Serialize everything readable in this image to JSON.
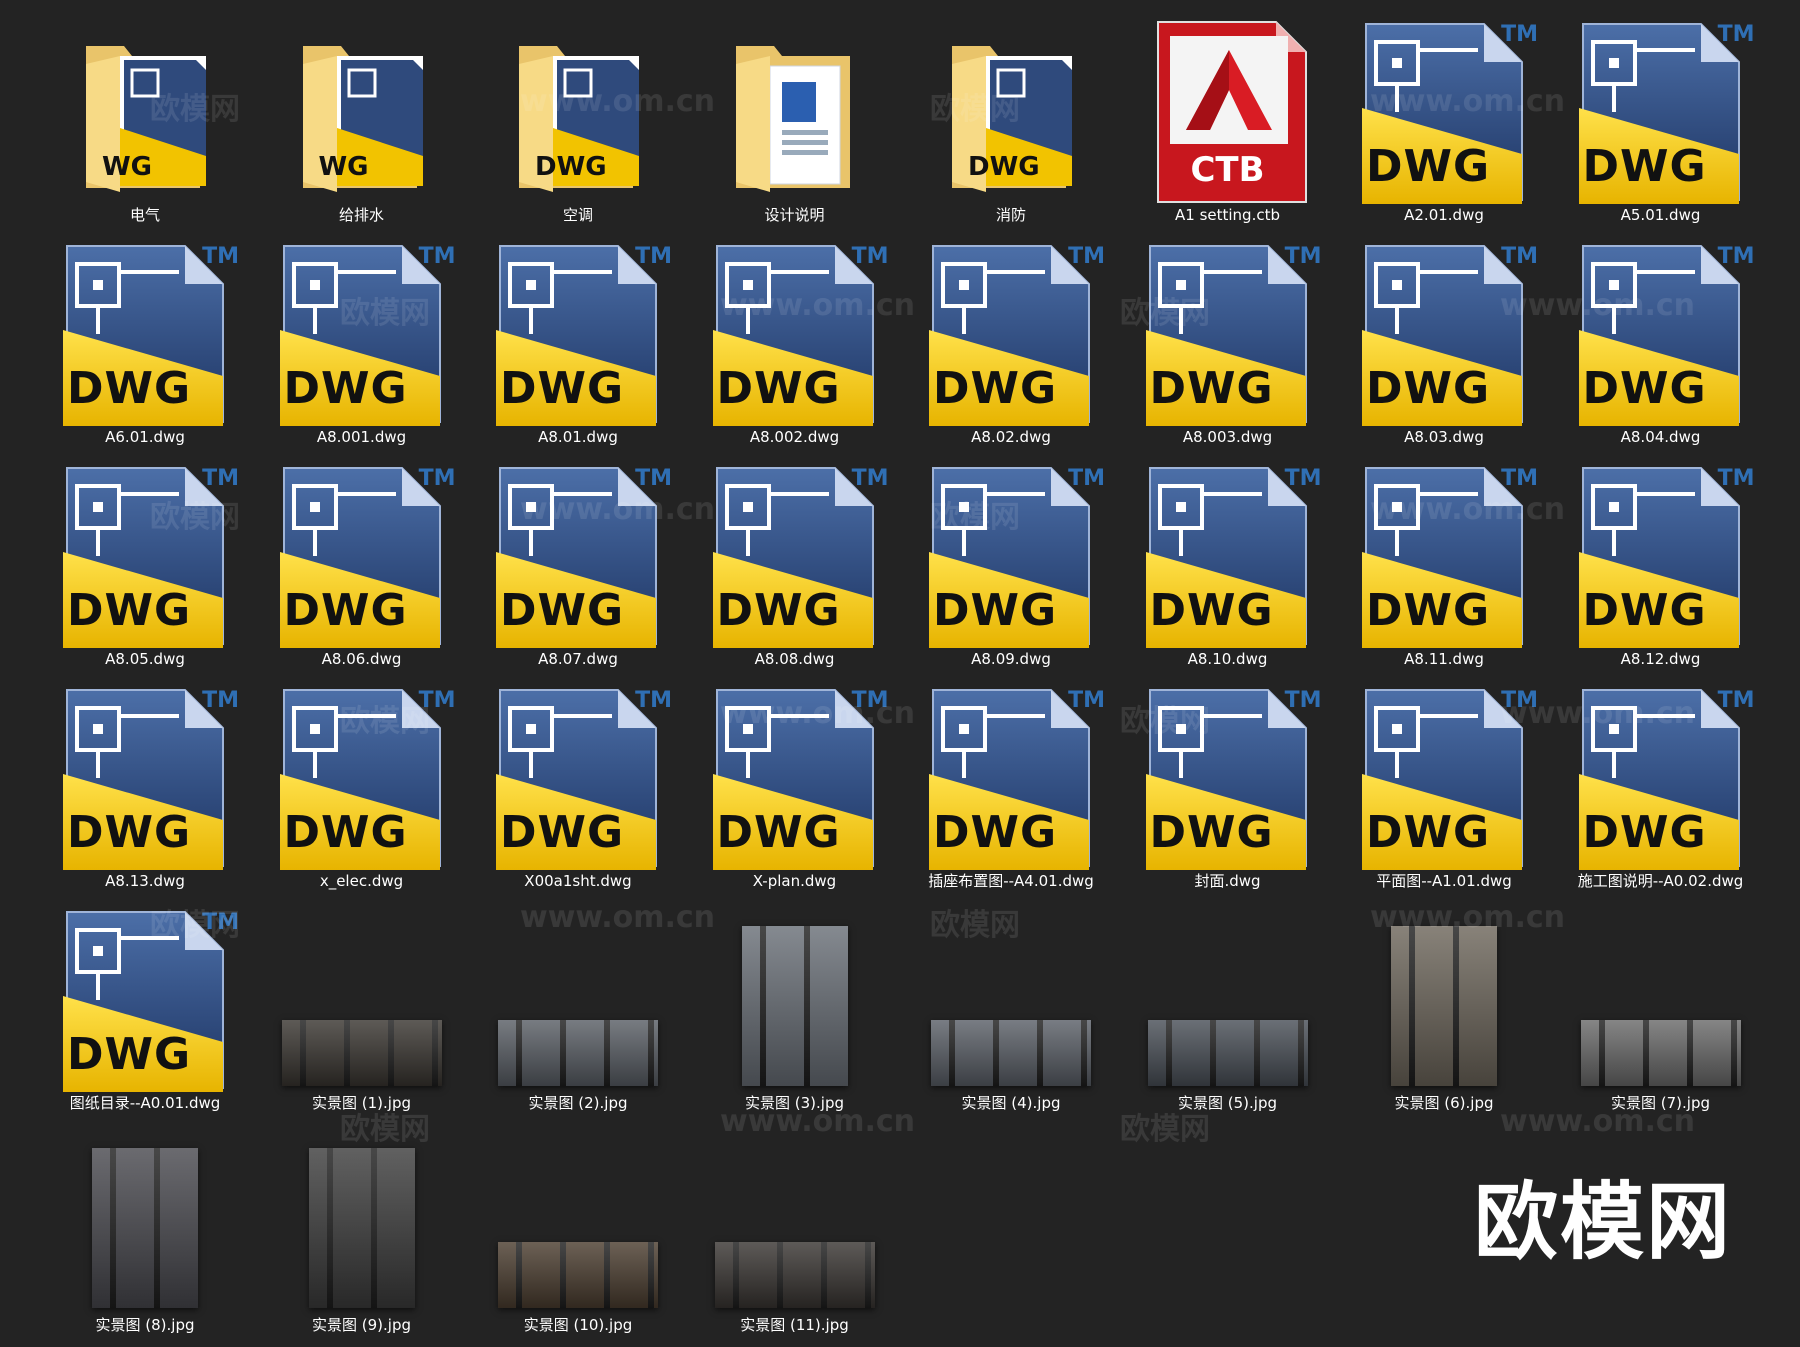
{
  "window": {
    "background": "#232323"
  },
  "items": [
    {
      "type": "folder",
      "label": "电气",
      "badge": "WG"
    },
    {
      "type": "folder",
      "label": "给排水",
      "badge": "WG"
    },
    {
      "type": "folder",
      "label": "空调",
      "badge": "DWG"
    },
    {
      "type": "folder-doc",
      "label": "设计说明"
    },
    {
      "type": "folder",
      "label": "消防",
      "badge": "DWG"
    },
    {
      "type": "ctb",
      "label": "A1  setting.ctb",
      "badge": "CTB"
    },
    {
      "type": "dwg",
      "label": "A2.01.dwg"
    },
    {
      "type": "dwg",
      "label": "A5.01.dwg"
    },
    {
      "type": "dwg",
      "label": "A6.01.dwg"
    },
    {
      "type": "dwg",
      "label": "A8.001.dwg"
    },
    {
      "type": "dwg",
      "label": "A8.01.dwg"
    },
    {
      "type": "dwg",
      "label": "A8.002.dwg"
    },
    {
      "type": "dwg",
      "label": "A8.02.dwg"
    },
    {
      "type": "dwg",
      "label": "A8.003.dwg"
    },
    {
      "type": "dwg",
      "label": "A8.03.dwg"
    },
    {
      "type": "dwg",
      "label": "A8.04.dwg"
    },
    {
      "type": "dwg",
      "label": "A8.05.dwg"
    },
    {
      "type": "dwg",
      "label": "A8.06.dwg"
    },
    {
      "type": "dwg",
      "label": "A8.07.dwg"
    },
    {
      "type": "dwg",
      "label": "A8.08.dwg"
    },
    {
      "type": "dwg",
      "label": "A8.09.dwg"
    },
    {
      "type": "dwg",
      "label": "A8.10.dwg"
    },
    {
      "type": "dwg",
      "label": "A8.11.dwg"
    },
    {
      "type": "dwg",
      "label": "A8.12.dwg"
    },
    {
      "type": "dwg",
      "label": "A8.13.dwg"
    },
    {
      "type": "dwg",
      "label": "x_elec.dwg"
    },
    {
      "type": "dwg",
      "label": "X00a1sht.dwg"
    },
    {
      "type": "dwg",
      "label": "X-plan.dwg"
    },
    {
      "type": "dwg",
      "label": "插座布置图--A4.01.dwg"
    },
    {
      "type": "dwg",
      "label": "封面.dwg"
    },
    {
      "type": "dwg",
      "label": "平面图--A1.01.dwg"
    },
    {
      "type": "dwg",
      "label": "施工图说明--A0.02.dwg"
    },
    {
      "type": "dwg",
      "label": "图纸目录--A0.01.dwg"
    },
    {
      "type": "photo",
      "label": "实景图 (1).jpg",
      "shape": "wide",
      "tone": "#3a3631"
    },
    {
      "type": "photo",
      "label": "实景图 (2).jpg",
      "shape": "wide",
      "tone": "#5a5f66"
    },
    {
      "type": "photo",
      "label": "实景图 (3).jpg",
      "shape": "tall",
      "tone": "#6a7078"
    },
    {
      "type": "photo",
      "label": "实景图 (4).jpg",
      "shape": "wide",
      "tone": "#5b6068"
    },
    {
      "type": "photo",
      "label": "实景图 (5).jpg",
      "shape": "wide",
      "tone": "#4a5058"
    },
    {
      "type": "photo",
      "label": "实景图 (6).jpg",
      "shape": "tall",
      "tone": "#6e675c"
    },
    {
      "type": "photo",
      "label": "实景图 (7).jpg",
      "shape": "wide",
      "tone": "#6b6b6b"
    },
    {
      "type": "photo",
      "label": "实景图 (8).jpg",
      "shape": "tall",
      "tone": "#4a4a50"
    },
    {
      "type": "photo",
      "label": "实景图 (9).jpg",
      "shape": "tall",
      "tone": "#3e3e3e"
    },
    {
      "type": "photo",
      "label": "实景图 (10).jpg",
      "shape": "wide",
      "tone": "#4c3e30"
    },
    {
      "type": "photo",
      "label": "实景图 (11).jpg",
      "shape": "wide",
      "tone": "#3a3633"
    }
  ],
  "watermarks": [
    "欧模网",
    "www.om.cn"
  ],
  "brand": "欧模网",
  "colors": {
    "dwg_blue": "#2f4a7c",
    "dwg_yellow": "#f2c300",
    "ctb_red": "#c8171e",
    "folder": "#f3d27a"
  },
  "icons": {
    "dwg": "dwg-file-icon",
    "ctb": "autocad-ctb-icon",
    "folder": "folder-icon",
    "photo": "jpg-thumbnail"
  }
}
